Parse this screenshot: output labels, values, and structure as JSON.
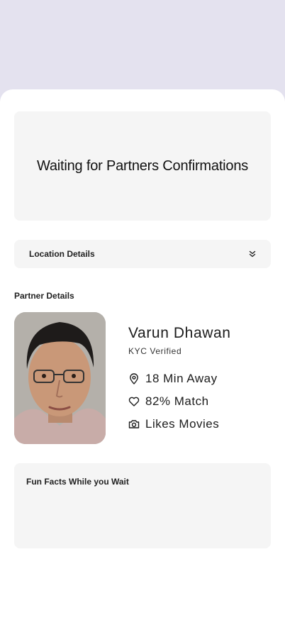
{
  "waiting": {
    "title": "Waiting for Partners Confirmations"
  },
  "location": {
    "label": "Location Details",
    "toggle_icon": "chevrons-down-icon"
  },
  "partner": {
    "section_label": "Partner Details",
    "name": "Varun Dhawan",
    "verification": "KYC Verified",
    "stats": [
      {
        "icon": "map-pin-icon",
        "text": "18 Min Away"
      },
      {
        "icon": "heart-icon",
        "text": "82% Match"
      },
      {
        "icon": "camera-icon",
        "text": "Likes Movies"
      }
    ]
  },
  "fun_facts": {
    "title": "Fun Facts While you Wait"
  },
  "colors": {
    "backdrop": "#e4e2ef",
    "card": "#f5f5f5",
    "sheet": "#ffffff",
    "text": "#141414"
  }
}
